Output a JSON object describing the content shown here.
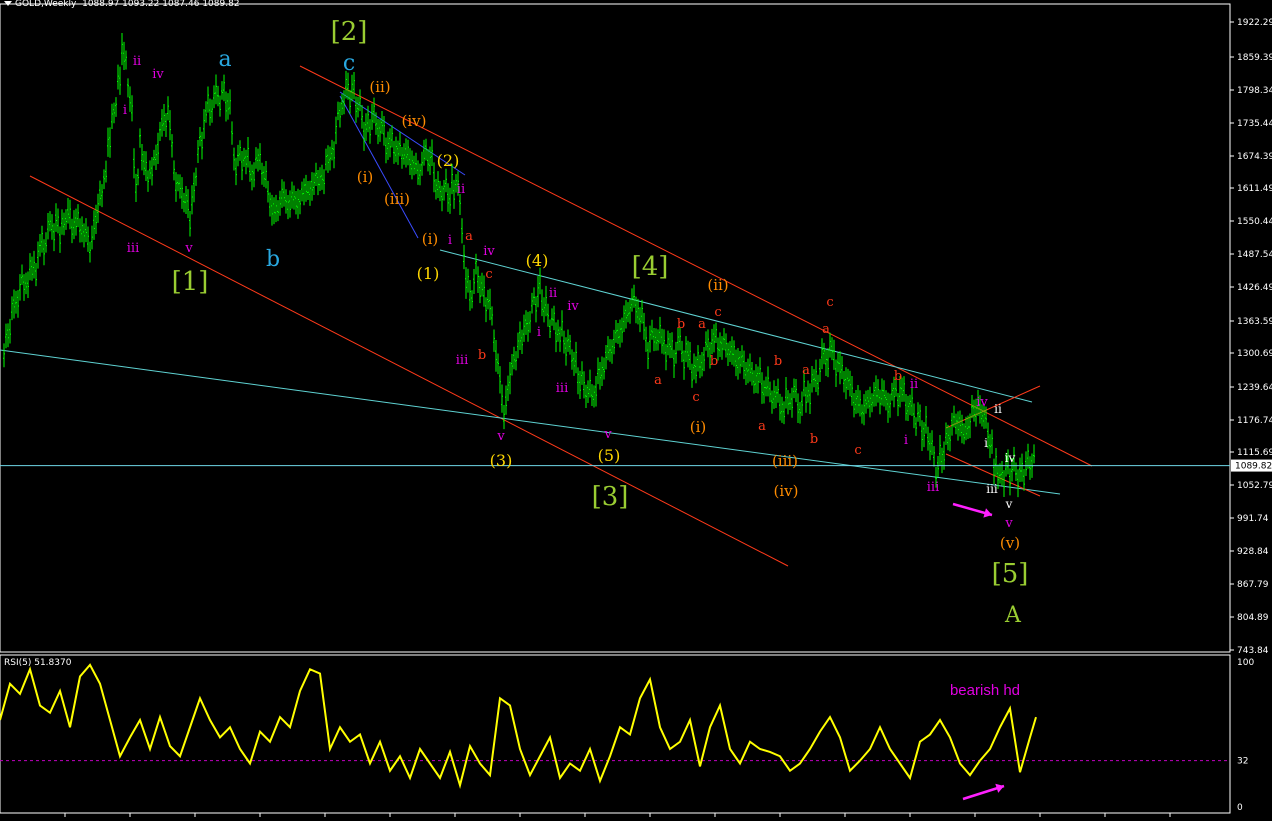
{
  "header": {
    "symbol": "GOLD,Weekly",
    "ohlc": "1088.97 1093.22 1087.46 1089.82"
  },
  "rsi_header": "RSI(5) 51.8370",
  "colors": {
    "background": "#000000",
    "candle": "#00ff00",
    "rsi_line": "#ffff00",
    "channel_red": "#ff3a1a",
    "channel_cyan": "#5fd3d3",
    "channel_blue": "#3a4cff",
    "level_32": "#c000c0",
    "current_price_line": "#6fd8e8",
    "axis": "#ffffff"
  },
  "chart_data": [
    {
      "type": "candlestick",
      "title": "GOLD,Weekly",
      "y_axis_ticks": [
        "1922.29",
        "1859.39",
        "1798.34",
        "1735.44",
        "1674.39",
        "1611.49",
        "1550.44",
        "1487.54",
        "1426.49",
        "1363.59",
        "1300.69",
        "1239.64",
        "1176.74",
        "1115.69",
        "1052.79",
        "991.74",
        "928.84",
        "867.79",
        "804.89",
        "743.84"
      ],
      "ylim": [
        735,
        1945
      ],
      "current_price": "1089.82",
      "x": [
        0,
        6,
        14,
        22,
        30,
        38,
        46,
        52,
        56,
        62,
        70,
        78,
        86,
        92,
        96,
        100,
        104,
        108,
        112,
        116,
        120,
        124,
        128,
        132,
        136,
        140,
        148,
        156,
        164,
        172,
        180,
        186,
        190,
        196,
        204,
        212,
        218,
        224,
        232,
        240,
        248,
        256,
        264,
        270,
        280,
        290,
        300,
        310,
        320,
        330,
        338,
        344,
        350,
        356,
        362,
        368,
        376,
        384,
        392,
        398,
        406,
        414,
        422,
        428,
        434,
        440,
        446,
        450,
        456,
        460,
        466,
        472,
        478,
        486,
        494,
        500,
        506,
        512,
        518,
        524,
        530,
        536,
        542,
        548,
        556,
        562,
        568,
        574,
        580,
        588,
        596,
        604,
        612,
        620,
        628,
        636,
        644,
        652,
        660,
        668,
        676,
        684,
        692,
        700,
        708,
        716,
        724,
        732,
        740,
        748,
        756,
        764,
        772,
        780,
        788,
        796,
        804,
        812,
        820,
        828,
        836,
        844,
        852,
        860,
        868,
        876,
        884,
        892,
        900,
        908,
        914,
        920,
        926,
        932,
        938,
        944,
        950,
        956,
        962,
        968,
        974,
        980,
        986,
        990,
        994,
        998,
        1004,
        1010,
        1016,
        1022,
        1028,
        1032
      ],
      "close": [
        1300,
        1360,
        1420,
        1440,
        1460,
        1500,
        1530,
        1550,
        1520,
        1560,
        1550,
        1540,
        1500,
        1560,
        1600,
        1620,
        1680,
        1730,
        1770,
        1830,
        1880,
        1820,
        1760,
        1600,
        1700,
        1650,
        1640,
        1720,
        1760,
        1620,
        1600,
        1560,
        1620,
        1700,
        1760,
        1780,
        1790,
        1780,
        1660,
        1680,
        1640,
        1670,
        1600,
        1570,
        1590,
        1580,
        1600,
        1620,
        1640,
        1700,
        1780,
        1800,
        1790,
        1760,
        1720,
        1750,
        1730,
        1700,
        1690,
        1680,
        1670,
        1640,
        1680,
        1660,
        1600,
        1610,
        1600,
        1620,
        1600,
        1480,
        1400,
        1460,
        1420,
        1390,
        1280,
        1180,
        1260,
        1300,
        1340,
        1360,
        1400,
        1420,
        1380,
        1360,
        1340,
        1320,
        1300,
        1260,
        1240,
        1220,
        1260,
        1300,
        1330,
        1360,
        1400,
        1380,
        1320,
        1340,
        1320,
        1300,
        1310,
        1290,
        1270,
        1300,
        1330,
        1320,
        1310,
        1290,
        1280,
        1260,
        1250,
        1230,
        1220,
        1200,
        1230,
        1210,
        1230,
        1250,
        1290,
        1300,
        1270,
        1250,
        1210,
        1200,
        1220,
        1230,
        1210,
        1230,
        1220,
        1190,
        1180,
        1160,
        1140,
        1080,
        1110,
        1140,
        1180,
        1170,
        1150,
        1190,
        1200,
        1180,
        1140,
        1100,
        1085,
        1075,
        1080,
        1085,
        1070,
        1090,
        1100,
        1089.82
      ]
    },
    {
      "type": "line",
      "title": "RSI(5) 51.8370",
      "y_axis_ticks": [
        "100",
        "32",
        "0"
      ],
      "ylim": [
        0,
        100
      ],
      "levels": [
        32
      ],
      "x": [
        0,
        10,
        20,
        30,
        40,
        50,
        60,
        70,
        80,
        90,
        100,
        110,
        120,
        130,
        140,
        150,
        160,
        170,
        180,
        190,
        200,
        210,
        220,
        230,
        240,
        250,
        260,
        270,
        280,
        290,
        300,
        310,
        320,
        330,
        340,
        350,
        360,
        370,
        380,
        390,
        400,
        410,
        420,
        430,
        440,
        450,
        460,
        470,
        480,
        490,
        500,
        510,
        520,
        530,
        540,
        550,
        560,
        570,
        580,
        590,
        600,
        610,
        620,
        630,
        640,
        650,
        660,
        670,
        680,
        690,
        700,
        710,
        720,
        730,
        740,
        750,
        760,
        770,
        780,
        790,
        800,
        810,
        820,
        830,
        840,
        850,
        860,
        870,
        880,
        890,
        900,
        910,
        920,
        930,
        940,
        950,
        960,
        970,
        980,
        990,
        1000,
        1010,
        1020,
        1030,
        1036
      ],
      "values": [
        60,
        85,
        78,
        95,
        70,
        65,
        80,
        55,
        90,
        98,
        85,
        60,
        35,
        48,
        60,
        40,
        62,
        42,
        35,
        55,
        75,
        60,
        48,
        55,
        40,
        30,
        52,
        45,
        62,
        55,
        80,
        95,
        92,
        40,
        55,
        45,
        50,
        30,
        45,
        25,
        35,
        20,
        40,
        30,
        20,
        38,
        15,
        42,
        30,
        22,
        75,
        70,
        40,
        22,
        35,
        48,
        20,
        30,
        25,
        40,
        18,
        35,
        55,
        50,
        75,
        88,
        55,
        40,
        45,
        60,
        28,
        55,
        70,
        40,
        30,
        45,
        40,
        38,
        35,
        25,
        30,
        40,
        52,
        62,
        48,
        25,
        32,
        40,
        55,
        40,
        30,
        20,
        45,
        50,
        60,
        48,
        30,
        22,
        32,
        40,
        55,
        68,
        24,
        48,
        62
      ]
    }
  ],
  "annotations": [
    {
      "text": "[2]",
      "color": "#9acd32",
      "size": 26
    },
    {
      "text": "c",
      "color": "#29a8e0",
      "size": 22
    },
    {
      "text": "a",
      "color": "#29a8e0",
      "size": 22
    },
    {
      "text": "b",
      "color": "#29a8e0",
      "size": 22
    },
    {
      "text": "[1]",
      "color": "#9acd32",
      "size": 26
    },
    {
      "text": "[3]",
      "color": "#9acd32",
      "size": 26
    },
    {
      "text": "[4]",
      "color": "#9acd32",
      "size": 26
    },
    {
      "text": "[5]",
      "color": "#9acd32",
      "size": 26
    },
    {
      "text": "A",
      "color": "#9acd32",
      "size": 22
    },
    {
      "text": "ii",
      "color": "#e000e0",
      "size": 13
    },
    {
      "text": "iv",
      "color": "#e000e0",
      "size": 13
    },
    {
      "text": "i",
      "color": "#e000e0",
      "size": 13
    },
    {
      "text": "iii",
      "color": "#e000e0",
      "size": 13
    },
    {
      "text": "v",
      "color": "#e000e0",
      "size": 13
    },
    {
      "text": "(ii)",
      "color": "#ff8c00",
      "size": 15
    },
    {
      "text": "(iv)",
      "color": "#ff8c00",
      "size": 15
    },
    {
      "text": "(i)",
      "color": "#ff8c00",
      "size": 15
    },
    {
      "text": "(iii)",
      "color": "#ff8c00",
      "size": 15
    },
    {
      "text": "(i)",
      "color": "#ff8c00",
      "size": 15
    },
    {
      "text": "(2)",
      "color": "#ffd700",
      "size": 16
    },
    {
      "text": "(1)",
      "color": "#ffd700",
      "size": 16
    },
    {
      "text": "(4)",
      "color": "#ffd700",
      "size": 16
    },
    {
      "text": "(3)",
      "color": "#ffd700",
      "size": 16
    },
    {
      "text": "(5)",
      "color": "#ffd700",
      "size": 16
    },
    {
      "text": "ii",
      "color": "#e000e0",
      "size": 13
    },
    {
      "text": "i",
      "color": "#e000e0",
      "size": 13
    },
    {
      "text": "a",
      "color": "#ff3a1a",
      "size": 13
    },
    {
      "text": "iv",
      "color": "#e000e0",
      "size": 13
    },
    {
      "text": "c",
      "color": "#ff3a1a",
      "size": 13
    },
    {
      "text": "b",
      "color": "#ff3a1a",
      "size": 13
    },
    {
      "text": "iii",
      "color": "#e000e0",
      "size": 13
    },
    {
      "text": "v",
      "color": "#e000e0",
      "size": 13
    },
    {
      "text": "ii",
      "color": "#e000e0",
      "size": 13
    },
    {
      "text": "i",
      "color": "#e000e0",
      "size": 13
    },
    {
      "text": "iv",
      "color": "#e000e0",
      "size": 13
    },
    {
      "text": "iii",
      "color": "#e000e0",
      "size": 13
    },
    {
      "text": "v",
      "color": "#e000e0",
      "size": 13
    },
    {
      "text": "a",
      "color": "#ff3a1a",
      "size": 13
    },
    {
      "text": "b",
      "color": "#ff3a1a",
      "size": 13
    },
    {
      "text": "a",
      "color": "#ff3a1a",
      "size": 13
    },
    {
      "text": "c",
      "color": "#ff3a1a",
      "size": 13
    },
    {
      "text": "(ii)",
      "color": "#ff8c00",
      "size": 15
    },
    {
      "text": "b",
      "color": "#ff3a1a",
      "size": 13
    },
    {
      "text": "c",
      "color": "#ff3a1a",
      "size": 13
    },
    {
      "text": "(i)",
      "color": "#ff8c00",
      "size": 15
    },
    {
      "text": "a",
      "color": "#ff3a1a",
      "size": 13
    },
    {
      "text": "b",
      "color": "#ff3a1a",
      "size": 13
    },
    {
      "text": "b",
      "color": "#ff3a1a",
      "size": 13
    },
    {
      "text": "a",
      "color": "#ff3a1a",
      "size": 13
    },
    {
      "text": "c",
      "color": "#ff3a1a",
      "size": 13
    },
    {
      "text": "(iii)",
      "color": "#ff8c00",
      "size": 15
    },
    {
      "text": "(iv)",
      "color": "#ff8c00",
      "size": 15
    },
    {
      "text": "c",
      "color": "#ff3a1a",
      "size": 13
    },
    {
      "text": "a",
      "color": "#ff3a1a",
      "size": 13
    },
    {
      "text": "b",
      "color": "#ff3a1a",
      "size": 13
    },
    {
      "text": "ii",
      "color": "#e000e0",
      "size": 13
    },
    {
      "text": "i",
      "color": "#e000e0",
      "size": 13
    },
    {
      "text": "iii",
      "color": "#e000e0",
      "size": 13
    },
    {
      "text": "iv",
      "color": "#e000e0",
      "size": 13
    },
    {
      "text": "ii",
      "color": "#ffffff",
      "size": 12
    },
    {
      "text": "i",
      "color": "#ffffff",
      "size": 12
    },
    {
      "text": "iv",
      "color": "#ffffff",
      "size": 12
    },
    {
      "text": "iii",
      "color": "#ffffff",
      "size": 12
    },
    {
      "text": "v",
      "color": "#ffffff",
      "size": 12
    },
    {
      "text": "v",
      "color": "#e000e0",
      "size": 13
    },
    {
      "text": "(v)",
      "color": "#ff8c00",
      "size": 15
    },
    {
      "text": "bearish hd",
      "color": "#e000e0",
      "size": 15
    }
  ]
}
